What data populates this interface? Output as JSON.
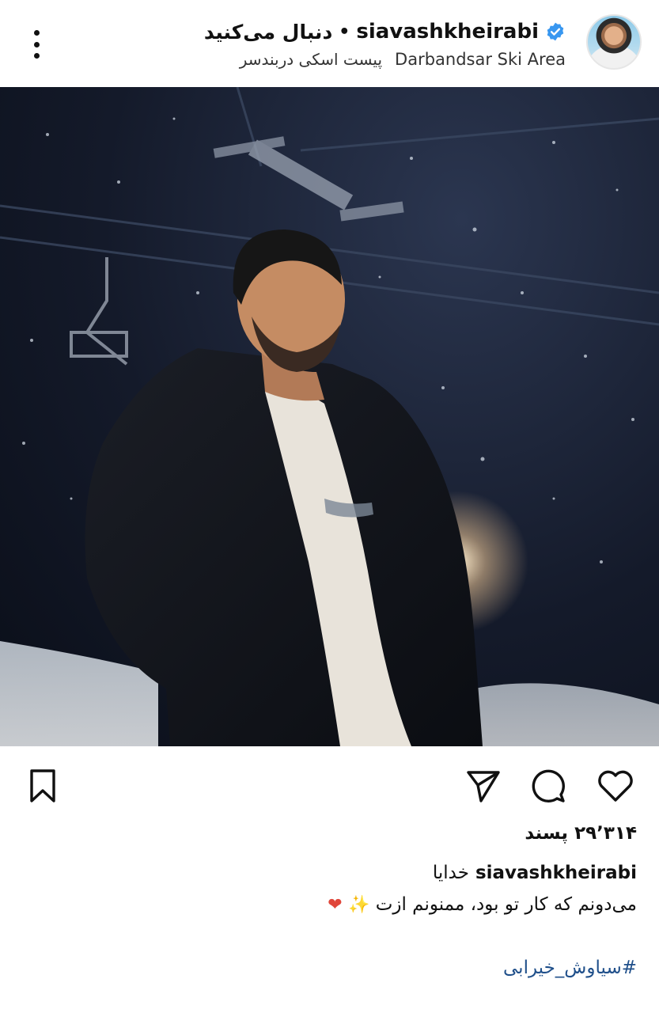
{
  "header": {
    "username": "siavashkheirabi",
    "dot": "•",
    "follow_label": "دنبال می‌کنید",
    "location_en": "Darbandsar Ski Area",
    "location_fa": "پیست اسکی دربندسر"
  },
  "icons": {
    "verified": "verified-badge-icon",
    "more": "more-options-icon",
    "save": "bookmark-icon",
    "share": "send-icon",
    "comment": "comment-icon",
    "like": "heart-icon"
  },
  "colors": {
    "verified": "#3897f0",
    "hashtag": "#1f4f8a"
  },
  "post": {
    "likes": "۲۹٬۳۱۴ پسند",
    "caption_user": "siavashkheirabi",
    "caption_line1": "خدایا",
    "caption_line2": "می‌دونم که کار تو بود، ممنونم ازت",
    "emoji_sparkles": "✨",
    "emoji_heart": "❤",
    "hashtag": "#سیاوش_خیرابی"
  }
}
